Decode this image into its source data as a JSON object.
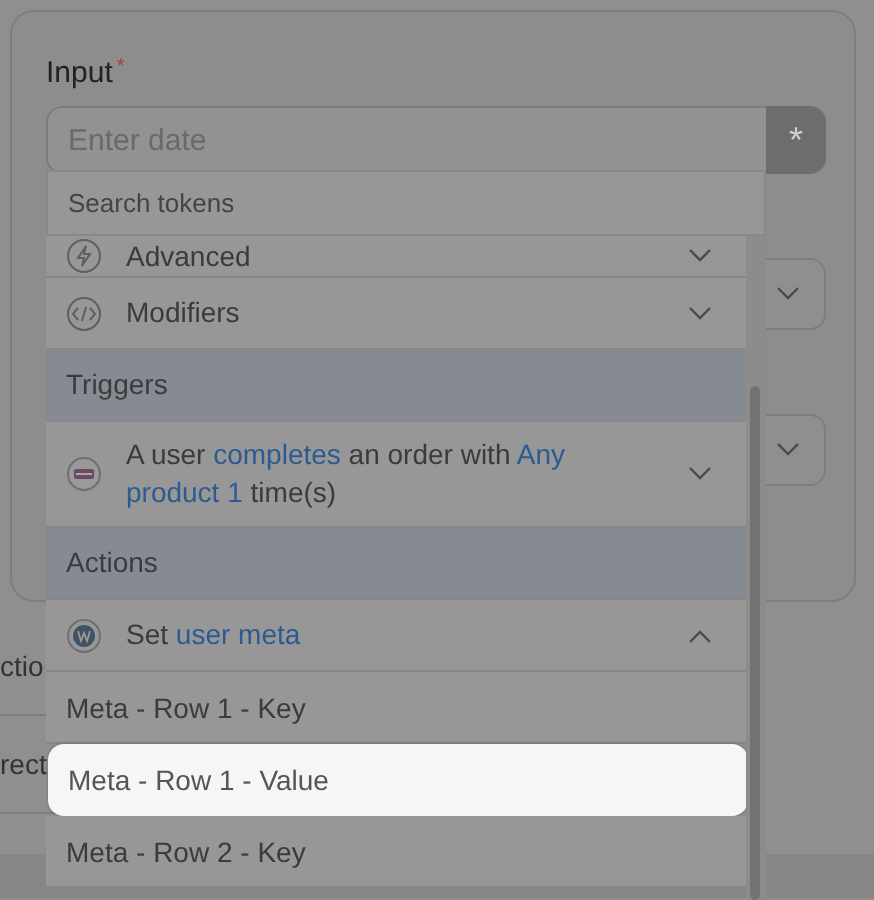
{
  "input": {
    "label": "Input",
    "required": true,
    "placeholder": "Enter date",
    "button": "*"
  },
  "background": {
    "cut_texts": [
      "ctio",
      "rect"
    ]
  },
  "token_menu": {
    "search_placeholder": "Search tokens",
    "items": [
      {
        "kind": "group",
        "parts": [
          {
            "text": "Advanced",
            "link": false
          }
        ],
        "expanded": false
      },
      {
        "kind": "group",
        "parts": [
          {
            "text": "Modifiers",
            "link": false
          }
        ],
        "expanded": false
      },
      {
        "kind": "section",
        "label": "Triggers"
      },
      {
        "kind": "group",
        "parts": [
          {
            "text": "A user",
            "link": false
          },
          {
            "text": "completes",
            "link": true
          },
          {
            "text": "an order with",
            "link": false
          },
          {
            "text": "Any product",
            "link": true
          },
          {
            "text": "1",
            "link": true
          },
          {
            "text": "time(s)",
            "link": false
          }
        ],
        "expanded": false
      },
      {
        "kind": "section",
        "label": "Actions"
      },
      {
        "kind": "group",
        "parts": [
          {
            "text": "Set",
            "link": false
          },
          {
            "text": "user meta",
            "link": true
          }
        ],
        "expanded": true
      },
      {
        "kind": "token",
        "label": "Meta - Row 1 - Key",
        "selected": false
      },
      {
        "kind": "token",
        "label": "Meta - Row 1 - Value",
        "selected": true
      },
      {
        "kind": "token",
        "label": "Meta - Row 2 - Key",
        "selected": false
      }
    ]
  }
}
